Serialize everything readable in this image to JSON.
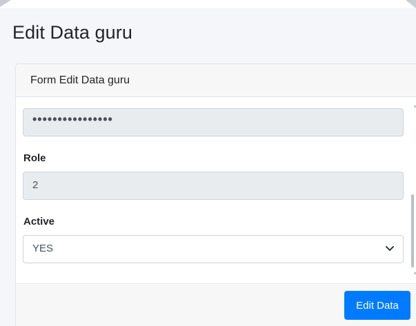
{
  "page": {
    "title": "Edit Data guru"
  },
  "card": {
    "header_title": "Form Edit Data guru"
  },
  "form": {
    "password": {
      "value": "••••••••••••••••"
    },
    "role": {
      "label": "Role",
      "value": "2"
    },
    "active": {
      "label": "Active",
      "selected": "YES"
    }
  },
  "footer": {
    "submit_label": "Edit Data"
  },
  "colors": {
    "primary": "#007bff",
    "readonly_bg": "#e9ecef",
    "card_header_bg": "#f7f7f7"
  },
  "icons": {
    "select_chevron": "chevron-down-icon"
  }
}
